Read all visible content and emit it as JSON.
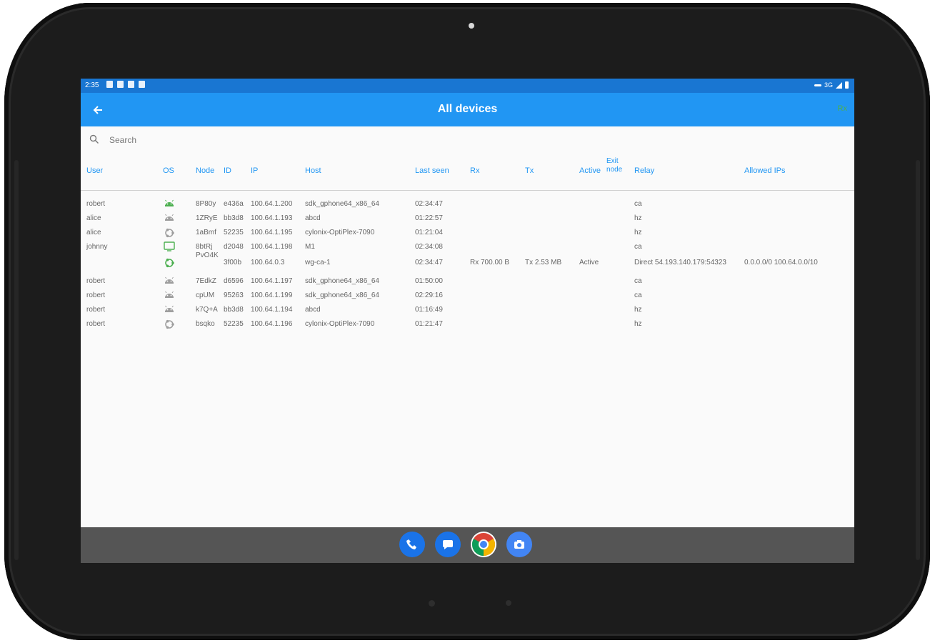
{
  "status": {
    "time": "2:35",
    "network": "3G"
  },
  "appbar": {
    "title": "All devices",
    "action_label": "Rx"
  },
  "search": {
    "placeholder": "Search",
    "value": ""
  },
  "columns": {
    "user": "User",
    "os": "OS",
    "node": "Node",
    "id": "ID",
    "ip": "IP",
    "host": "Host",
    "last_seen": "Last seen",
    "rx": "Rx",
    "tx": "Tx",
    "active": "Active",
    "exit_node": "Exit node",
    "relay": "Relay",
    "allowed_ips": "Allowed IPs"
  },
  "rows": [
    {
      "user": "robert",
      "os": "android-icon",
      "os_color": "#4caf50",
      "node": "8P80y",
      "id": "e436a",
      "ip": "100.64.1.200",
      "host": "sdk_gphone64_x86_64",
      "last_seen": "02:34:47",
      "rx": "",
      "tx": "",
      "active": "",
      "exit_node": "",
      "relay": "ca",
      "allowed_ips": ""
    },
    {
      "user": "alice",
      "os": "android-icon",
      "os_color": "#9e9e9e",
      "node": "1ZRyE",
      "id": "bb3d8",
      "ip": "100.64.1.193",
      "host": "abcd",
      "last_seen": "01:22:57",
      "rx": "",
      "tx": "",
      "active": "",
      "exit_node": "",
      "relay": "hz",
      "allowed_ips": ""
    },
    {
      "user": "alice",
      "os": "ubuntu-icon",
      "os_color": "#9e9e9e",
      "node": "1aBmf",
      "id": "52235",
      "ip": "100.64.1.195",
      "host": "cylonix-OptiPlex-7090",
      "last_seen": "01:21:04",
      "rx": "",
      "tx": "",
      "active": "",
      "exit_node": "",
      "relay": "hz",
      "allowed_ips": ""
    },
    {
      "user": "johnny",
      "os": "monitor-icon",
      "os_color": "#4caf50",
      "node": "8btRj",
      "id": "d2048",
      "ip": "100.64.1.198",
      "host": "M1",
      "last_seen": "02:34:08",
      "rx": "",
      "tx": "",
      "active": "",
      "exit_node": "",
      "relay": "ca",
      "allowed_ips": ""
    },
    {
      "user": "",
      "os": "ubuntu-icon",
      "os_color": "#4caf50",
      "node": "PvO4K",
      "id": "3f00b",
      "ip": "100.64.0.3",
      "host": "wg-ca-1",
      "last_seen": "02:34:47",
      "rx": "Rx 700.00 B",
      "tx": "Tx 2.53 MB",
      "active": "Active",
      "exit_node": "",
      "relay": "Direct 54.193.140.179:54323",
      "allowed_ips": "0.0.0.0/0 100.64.0.0/10"
    },
    {
      "user": "robert",
      "os": "android-icon",
      "os_color": "#9e9e9e",
      "node": "7EdkZ",
      "id": "d6596",
      "ip": "100.64.1.197",
      "host": "sdk_gphone64_x86_64",
      "last_seen": "01:50:00",
      "rx": "",
      "tx": "",
      "active": "",
      "exit_node": "",
      "relay": "ca",
      "allowed_ips": ""
    },
    {
      "user": "robert",
      "os": "android-icon",
      "os_color": "#9e9e9e",
      "node": "cpUM",
      "id": "95263",
      "ip": "100.64.1.199",
      "host": "sdk_gphone64_x86_64",
      "last_seen": "02:29:16",
      "rx": "",
      "tx": "",
      "active": "",
      "exit_node": "",
      "relay": "ca",
      "allowed_ips": ""
    },
    {
      "user": "robert",
      "os": "android-icon",
      "os_color": "#9e9e9e",
      "node": "k7Q+A",
      "id": "bb3d8",
      "ip": "100.64.1.194",
      "host": "abcd",
      "last_seen": "01:16:49",
      "rx": "",
      "tx": "",
      "active": "",
      "exit_node": "",
      "relay": "hz",
      "allowed_ips": ""
    },
    {
      "user": "robert",
      "os": "ubuntu-icon",
      "os_color": "#9e9e9e",
      "node": "bsqko",
      "id": "52235",
      "ip": "100.64.1.196",
      "host": "cylonix-OptiPlex-7090",
      "last_seen": "01:21:47",
      "rx": "",
      "tx": "",
      "active": "",
      "exit_node": "",
      "relay": "hz",
      "allowed_ips": ""
    }
  ],
  "dock": [
    {
      "name": "phone-icon",
      "color": "#1a73e8"
    },
    {
      "name": "messages-icon",
      "color": "#1a73e8"
    },
    {
      "name": "chrome-icon",
      "color": "#ffffff"
    },
    {
      "name": "camera-icon",
      "color": "#4285f4"
    }
  ],
  "colors": {
    "appbar": "#2196f3",
    "statusbar": "#1976d2",
    "header_text": "#2196f3",
    "navbar": "#555555"
  }
}
